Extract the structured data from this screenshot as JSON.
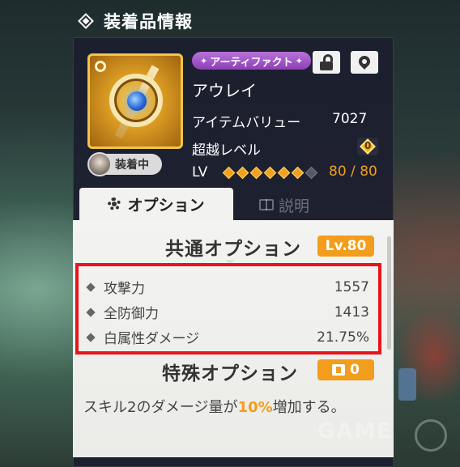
{
  "header": {
    "title": "装着品情報",
    "icon": "diamond-icon"
  },
  "item": {
    "icon": "artifact-sun-gem-icon",
    "equipped_label": "装着中",
    "category_badge": "アーティファクト",
    "name": "アウレイ",
    "value_label": "アイテムバリュー",
    "value": "7027",
    "transcend_label": "超越レベル",
    "transcend_value": "0",
    "lv_label": "LV",
    "lv_current": "80",
    "lv_separator": "/",
    "lv_max": "80",
    "lv_stars_filled": 6,
    "lv_stars_total": 7
  },
  "buttons": {
    "lock_icon": "lock-icon",
    "pin_icon": "map-pin-icon"
  },
  "tabs": [
    {
      "label": "オプション",
      "icon": "gear-icon",
      "active": true
    },
    {
      "label": "説明",
      "icon": "book-icon",
      "active": false
    }
  ],
  "common_options": {
    "title": "共通オプション",
    "level": "Lv.80",
    "rows": [
      {
        "label": "攻撃力",
        "value": "1557"
      },
      {
        "label": "全防御力",
        "value": "1413"
      },
      {
        "label": "白属性ダメージ",
        "value": "21.75%"
      }
    ]
  },
  "special_options": {
    "title": "特殊オプション",
    "count": "0",
    "desc_before": "スキル2のダメージ量が",
    "desc_highlight": "10%",
    "desc_after": "増加する。"
  },
  "colors": {
    "accent": "#f29d1c",
    "highlight_box": "#e8141c",
    "badge_purple": "#9a4cc4"
  }
}
